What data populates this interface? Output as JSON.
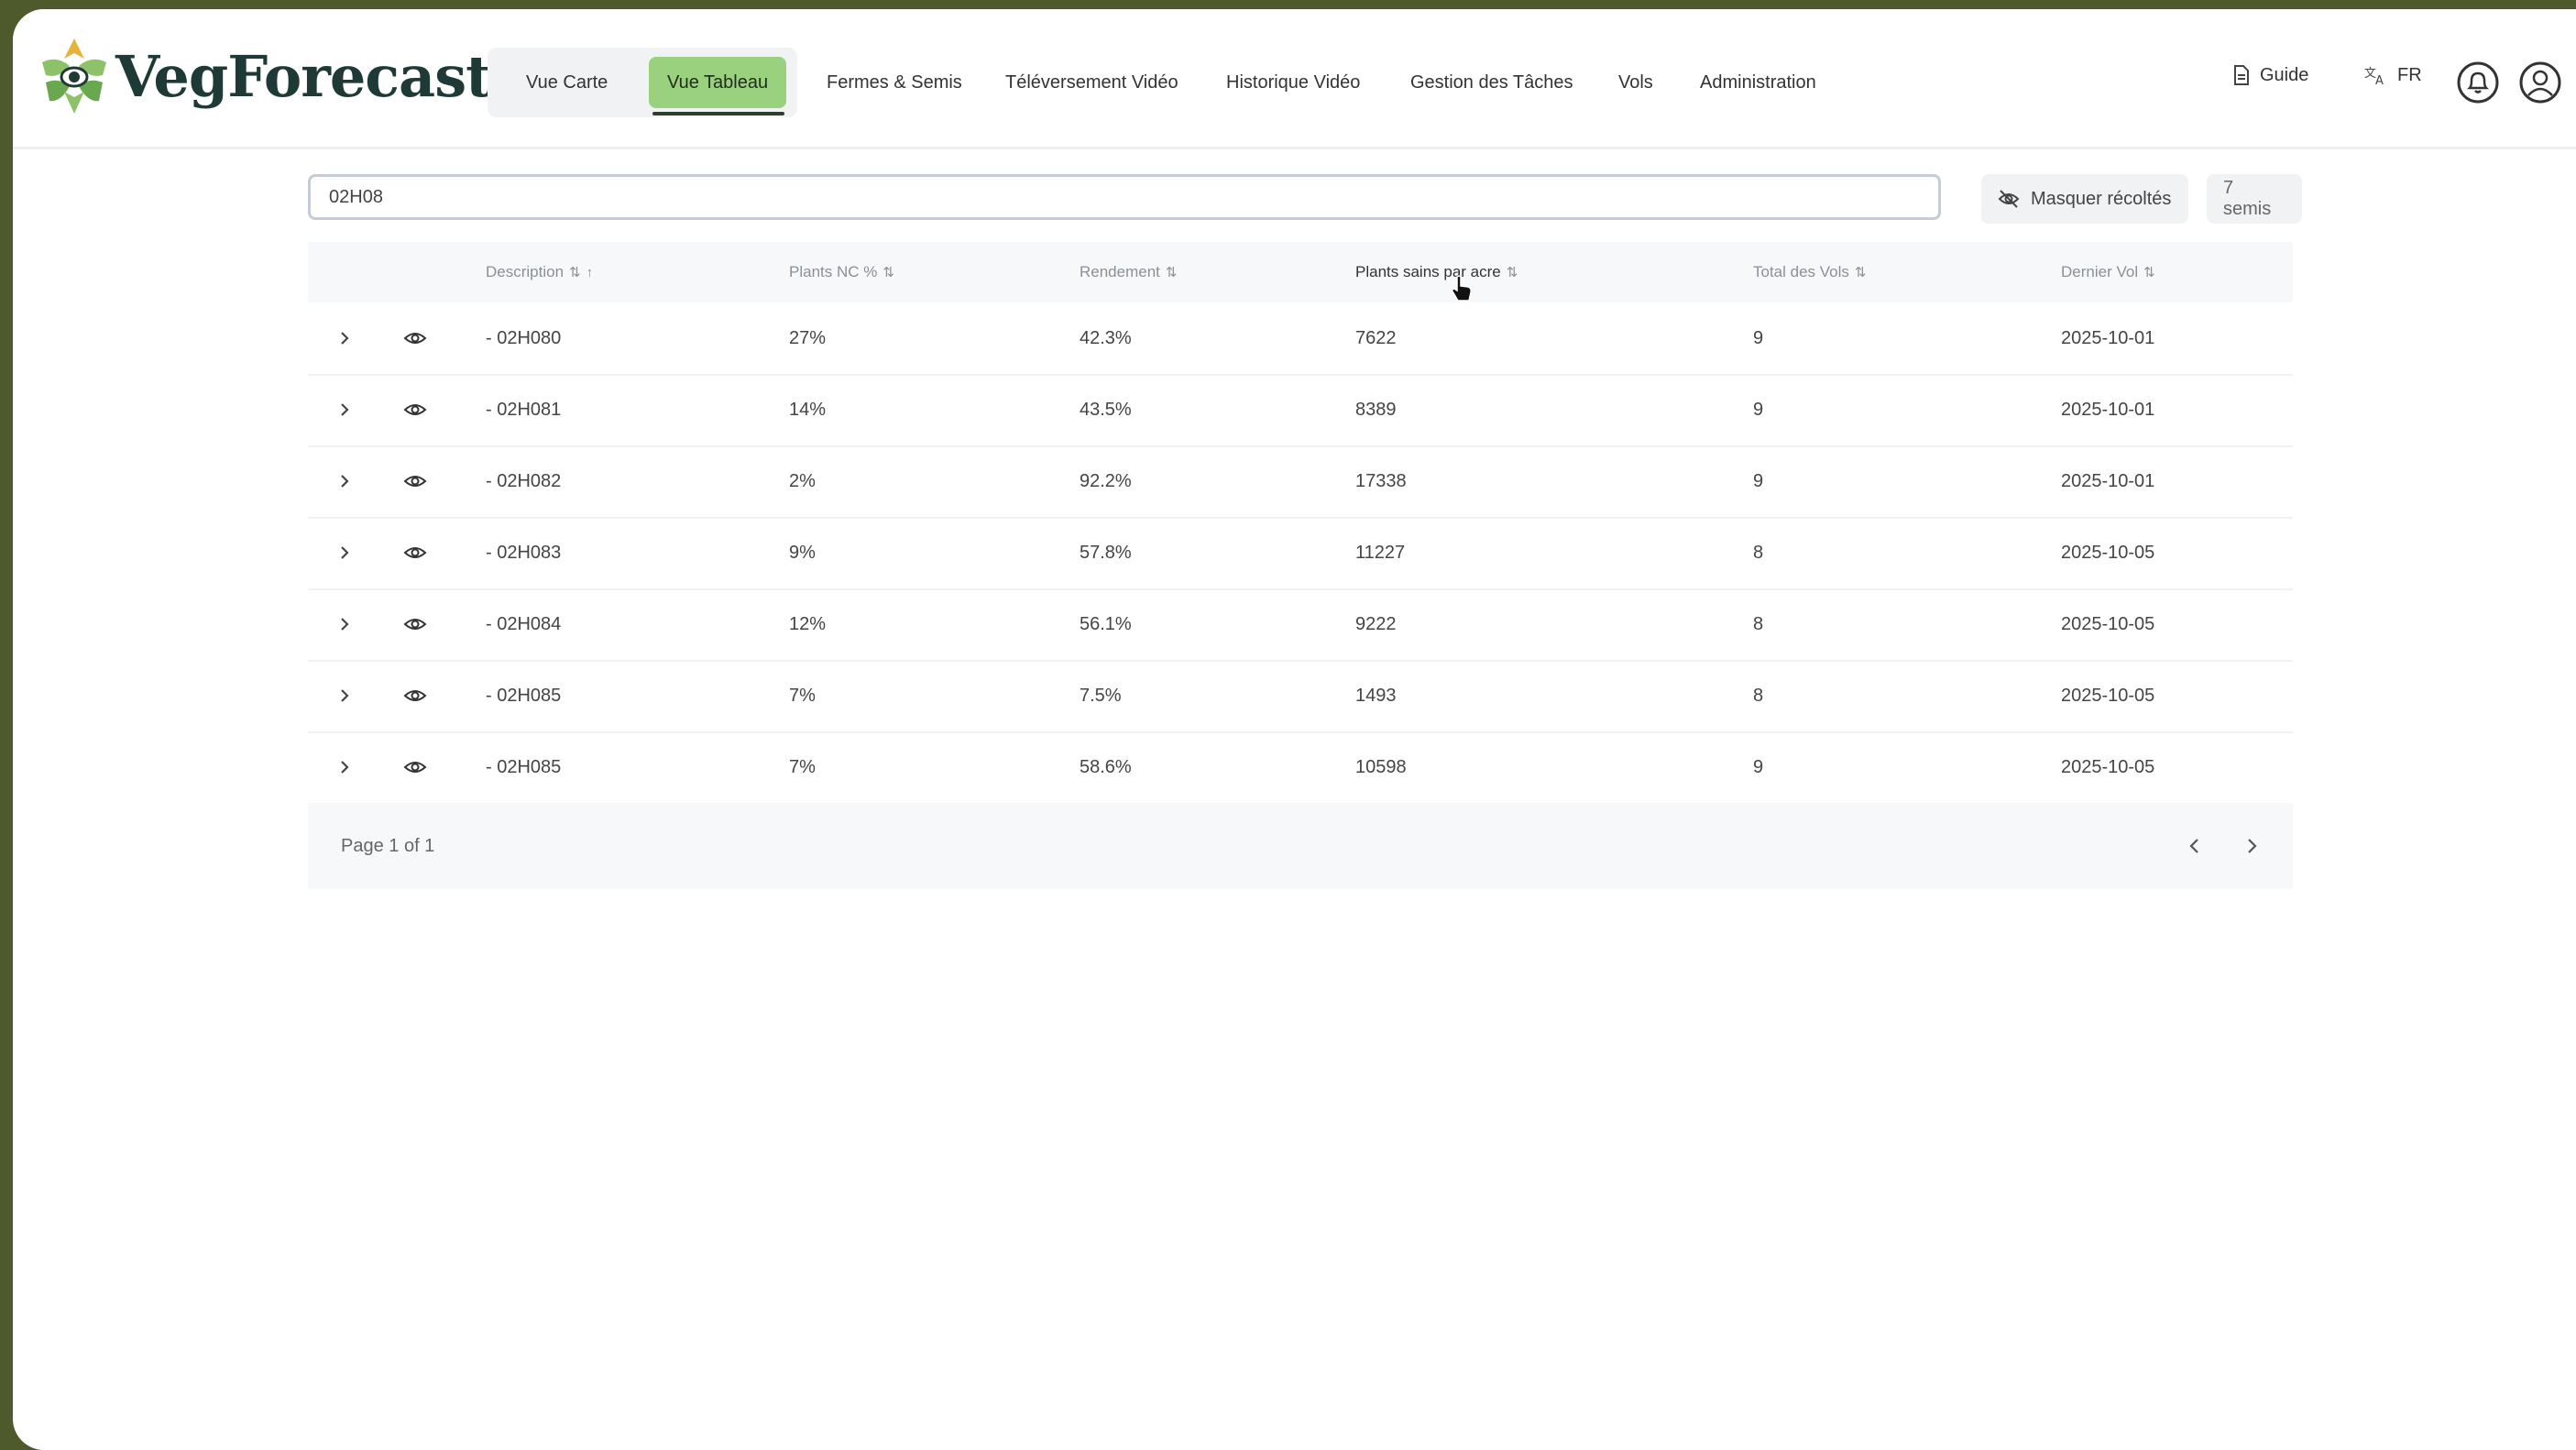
{
  "app": {
    "brand": "VegForecast"
  },
  "nav": {
    "items": [
      {
        "label": "Vue Carte"
      },
      {
        "label": "Vue Tableau"
      },
      {
        "label": "Fermes & Semis"
      },
      {
        "label": "Téléversement Vidéo"
      },
      {
        "label": "Historique Vidéo"
      },
      {
        "label": "Gestion des Tâches"
      },
      {
        "label": "Vols"
      },
      {
        "label": "Administration"
      }
    ],
    "active": "Vue Tableau"
  },
  "header_right": {
    "guide": "Guide",
    "language": "FR"
  },
  "search": {
    "value": "02H08"
  },
  "toolbar": {
    "hide_harvested": "Masquer récoltés",
    "count": "7 semis"
  },
  "table": {
    "columns": [
      "Description",
      "Plants NC %",
      "Rendement",
      "Plants sains par acre",
      "Total des Vols",
      "Dernier Vol"
    ],
    "sort_glyph": "⇅",
    "sort_active": "↑",
    "rows": [
      {
        "description": "- 02H080",
        "nc": "27%",
        "rendement": "42.3%",
        "plants_sains": "7622",
        "vols": "9",
        "dernier": "2025-10-01"
      },
      {
        "description": "- 02H081",
        "nc": "14%",
        "rendement": "43.5%",
        "plants_sains": "8389",
        "vols": "9",
        "dernier": "2025-10-01"
      },
      {
        "description": "- 02H082",
        "nc": "2%",
        "rendement": "92.2%",
        "plants_sains": "17338",
        "vols": "9",
        "dernier": "2025-10-01"
      },
      {
        "description": "- 02H083",
        "nc": "9%",
        "rendement": "57.8%",
        "plants_sains": "11227",
        "vols": "8",
        "dernier": "2025-10-05"
      },
      {
        "description": "- 02H084",
        "nc": "12%",
        "rendement": "56.1%",
        "plants_sains": "9222",
        "vols": "8",
        "dernier": "2025-10-05"
      },
      {
        "description": "- 02H085",
        "nc": "7%",
        "rendement": "7.5%",
        "plants_sains": "1493",
        "vols": "8",
        "dernier": "2025-10-05"
      },
      {
        "description": "- 02H085",
        "nc": "7%",
        "rendement": "58.6%",
        "plants_sains": "10598",
        "vols": "9",
        "dernier": "2025-10-05"
      }
    ],
    "pagination": "Page 1 of 1"
  },
  "colors": {
    "accent": "#9ad17f",
    "frame": "#4f5a2c",
    "brand_text": "#1f3a36"
  },
  "icons": [
    "leaf-eye-logo-icon",
    "document-icon",
    "translate-icon",
    "bell-icon",
    "user-icon",
    "eye-off-icon",
    "chevron-right-icon",
    "eye-icon",
    "chevron-left-icon",
    "pointer-cursor-icon"
  ]
}
